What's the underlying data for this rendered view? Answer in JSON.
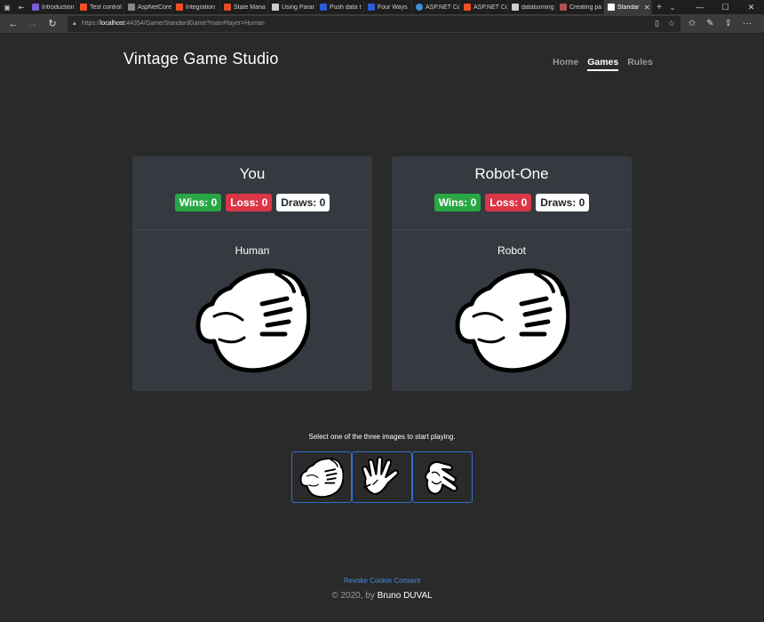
{
  "browser": {
    "tabs": [
      {
        "label": "Introduction",
        "color": "#7b5cd6"
      },
      {
        "label": "Test control",
        "color": "#f25022"
      },
      {
        "label": "AspNetCore",
        "color": "#888888"
      },
      {
        "label": "Integration",
        "color": "#f25022"
      },
      {
        "label": "State Mana",
        "color": "#e34c26"
      },
      {
        "label": "Using Parar",
        "color": "#cccccc"
      },
      {
        "label": "Push data t",
        "color": "#2d5bd6"
      },
      {
        "label": "Four Ways",
        "color": "#2d5bd6"
      },
      {
        "label": "ASP.NET Cc",
        "color": "#3a8fd6"
      },
      {
        "label": "ASP.NET Cc",
        "color": "#f25022"
      },
      {
        "label": "datatunning",
        "color": "#cccccc"
      },
      {
        "label": "Creating pa",
        "color": "#b05050"
      },
      {
        "label": "Standar",
        "color": "#ffffff"
      }
    ],
    "url_prefix": "https://",
    "url_host": "localhost",
    "url_rest": ":44354/Game/StandardGame?mainPlayer=Human"
  },
  "header": {
    "brand": "Vintage Game Studio",
    "nav": [
      "Home",
      "Games",
      "Rules"
    ]
  },
  "players": [
    {
      "name": "You",
      "type": "Human",
      "wins": "Wins: 0",
      "loss": "Loss: 0",
      "draws": "Draws: 0"
    },
    {
      "name": "Robot-One",
      "type": "Robot",
      "wins": "Wins: 0",
      "loss": "Loss: 0",
      "draws": "Draws: 0"
    }
  ],
  "game": {
    "prompt": "Select one of the three images to start playing.",
    "choices": [
      "rock-hand-icon",
      "paper-hand-icon",
      "scissors-hand-icon"
    ]
  },
  "footer": {
    "revoke": "Revoke Cookie Consent",
    "copy": "© 2020, by ",
    "author": "Bruno DUVAL"
  }
}
